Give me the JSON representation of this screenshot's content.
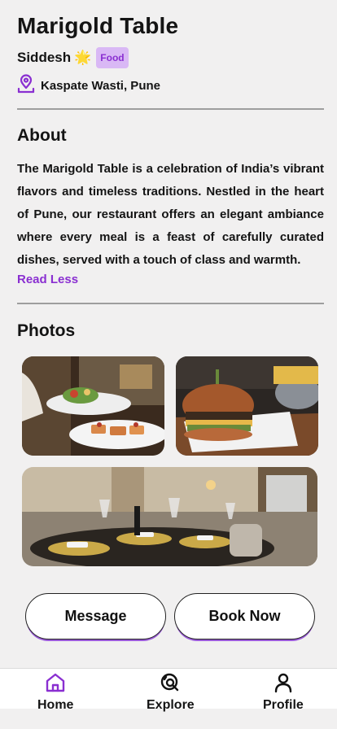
{
  "restaurant": {
    "name": "Marigold Table",
    "owner": "Siddesh",
    "owner_emoji": "🌟",
    "category_badge": "Food",
    "location": "Kaspate Wasti, Pune"
  },
  "about": {
    "heading": "About",
    "text": "The Marigold Table is a celebration of India’s vibrant flavors and timeless traditions. Nestled in the heart of Pune, our restaurant offers an elegant ambiance where every meal is a feast of carefully curated dishes, served with a touch of class and warmth.",
    "toggle_label": "Read Less"
  },
  "photos": {
    "heading": "Photos"
  },
  "actions": {
    "message_label": "Message",
    "book_label": "Book Now"
  },
  "tabbar": {
    "items": [
      {
        "label": "Home",
        "icon": "home-icon",
        "active": true
      },
      {
        "label": "Explore",
        "icon": "explore-icon",
        "active": false
      },
      {
        "label": "Profile",
        "icon": "profile-icon",
        "active": false
      }
    ]
  },
  "colors": {
    "accent": "#8a2fd1",
    "badge_bg": "#d9b8f5",
    "background": "#f1f0f0"
  }
}
